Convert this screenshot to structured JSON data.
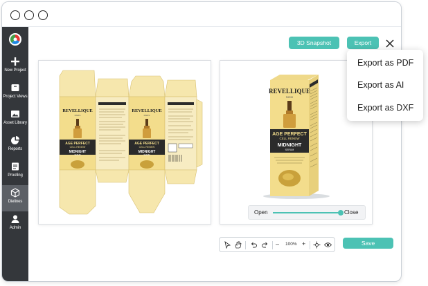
{
  "sidebar": {
    "items": [
      {
        "label": "New Project",
        "icon": "plus-icon"
      },
      {
        "label": "Project Views",
        "icon": "project-views-icon"
      },
      {
        "label": "Asset Library",
        "icon": "image-icon"
      },
      {
        "label": "Reports",
        "icon": "pie-chart-icon"
      },
      {
        "label": "Proofing",
        "icon": "proofing-icon"
      },
      {
        "label": "Dielines",
        "icon": "cube-icon",
        "active": true
      },
      {
        "label": "Admin",
        "icon": "user-icon"
      }
    ]
  },
  "header": {
    "snapshot_label": "3D Snapshot",
    "export_label": "Export"
  },
  "export_menu": {
    "items": [
      "Export as PDF",
      "Export as AI",
      "Export as DXF"
    ]
  },
  "preview": {
    "slider": {
      "open_label": "Open",
      "close_label": "Close",
      "value": 1.0
    }
  },
  "toolbar": {
    "zoom": "100%",
    "minus": "–",
    "plus": "+"
  },
  "save_label": "Save",
  "artwork": {
    "brand": "REVELLIQUE",
    "city": "PARIS",
    "line1": "AGE PERFECT",
    "line2": "CELL RENEW",
    "product": "MIDNIGHT",
    "product_sub": "SERUM"
  },
  "colors": {
    "accent": "#4cc2b4",
    "sidebar": "#34373b",
    "sidebar_active": "#5c6066",
    "box_gold": "#f3dd8c",
    "label_dark": "#2b2b2b"
  }
}
